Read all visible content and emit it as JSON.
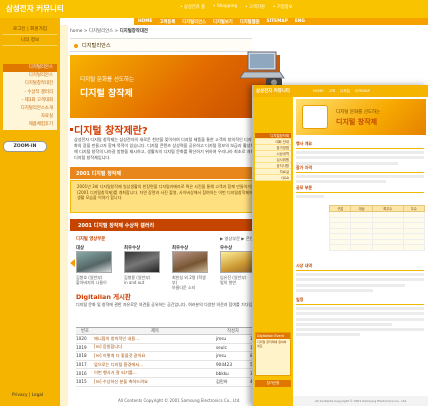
{
  "header": {
    "logo": "삼성전자 커뮤니티",
    "top_links": [
      "• 삼성전자 홈",
      "• Shopping",
      "• 고객지원",
      "• 기업정보"
    ],
    "nav": [
      "HOME",
      "고객등록",
      "디지털리안스",
      "디지털보기",
      "디지털웹원",
      "SITEMAP",
      "ENG"
    ]
  },
  "sidebar": {
    "top_items": [
      "로그인 | 회원가입",
      "나의 정보"
    ],
    "menu": [
      "디지털리안스",
      "디지털리안스",
      "디지털창작대전",
      "- 수상작 갤러리",
      "- 제3회 고객대회",
      "디지털리안스소개",
      "자료실",
      "제품체험후기"
    ],
    "zoom_button": "ZOOM-IN",
    "privacy": "Privacy   |   Legal"
  },
  "breadcrumb": {
    "prefix": "home > 디지털리안스 > ",
    "current": "디지털창작대전"
  },
  "page_title": "디지털리안스",
  "banner": {
    "sub": "디지털 문화를 선도하는",
    "main": "디지털 창작제"
  },
  "intro": {
    "title": "디지털 창작제란?",
    "text": "삼성전자 디지털 창작제는 삼성전자의 새로운 천년을 맞이하여 디지털 제품을 통한 고객의 창의적인 디지털 문화의 장을 만들고자 함에 목적이 있습니다. 디지털 콘텐츠 상상력을 공유하고 디지털 정보의 보급과 활성화를 위해 디지털 창작의 나아갈 방향을 제시하고, 생활속의 디지털 문화를 확산하기 위하여 우리나라 최초로 개최되는 디지털 창작제입니다."
  },
  "section1": {
    "title": "2001 디지털 창작제",
    "text": "2001년 3회 디지털창작제 일상생활의 한장면을 디지털카메라로 찍은 사진을 통해 고객과 함께 만들어가는 (2001 디지털창작제)를 개최합니다. 자연 장면과 사진 촬영, 사이버상에서 참여하는 이번 디지털창작제에서는 생활 모습을 이야기 합니다."
  },
  "section2": {
    "title": "2001 디지털 창작제 수상작 갤러리",
    "subcaption": "디지털 영상부문",
    "more": "▶ 영상부문 ▶ 콘텐츠부문",
    "thumbs": [
      {
        "cap": "대상",
        "name": "김봉호 (일반부)\n할아버지의 나들이"
      },
      {
        "cap": "최우수상",
        "name": "김병용 (일반부)\nin and out"
      },
      {
        "cap": "최우수상",
        "name": "최한성 외 2명 (학생부)\n아름다운 소리"
      },
      {
        "cap": "우수상",
        "name": "임유진 (일반부)\n빛의 향연"
      }
    ]
  },
  "board": {
    "title": "Digitalian 게시판",
    "desc": "디지털 문화 및 창작에 관한 자유로운 의견을 공유하는 공간입니다. 여러분의 다양한 의견과 참여를 기다립니다.",
    "columns": [
      "번호",
      "제목",
      "작성자",
      "조회"
    ],
    "rows": [
      [
        "1020",
        "애니팝의 창의적인 내용...",
        "jmsu",
        "11"
      ],
      [
        "1019",
        "[re] 응원합니다",
        "seulc",
        "19"
      ],
      [
        "1018",
        "[re] 이렇게 더 좋을것 같아요",
        "jmsu",
        "8"
      ],
      [
        "1017",
        "앞으로는 디지털 환경에서...",
        "904423",
        "53"
      ],
      [
        "1016",
        "이번 행사가 잘 되기를...",
        "bbkku",
        "35"
      ],
      [
        "1015",
        "[re] 수상하신 분들 축하드려요",
        "김민하",
        "46"
      ]
    ]
  },
  "copyright": "All Contents Copyright © 2001 Samsung Electronics Co., Ltd.",
  "front": {
    "logo": "삼성전자 커뮤니티",
    "nav": [
      "HOME",
      "고객",
      "디지털",
      "SITEMAP"
    ],
    "menu": [
      "디지털창작제",
      "대회 안내",
      "참가방법",
      "시상내역",
      "심사위원",
      "공지사항",
      "자료실",
      "Q&A"
    ],
    "banner_sub": "디지털 문화를 선도하는",
    "banner_main": "디지털 창작제",
    "sections": [
      "행사 개요",
      "참가 자격",
      "공모 부문",
      "시상 내역",
      "일정"
    ],
    "table_head": [
      "구분",
      "대상",
      "최우수",
      "우수"
    ],
    "promo_head": "Digitalian Event",
    "promo_text": "디지털 창작제에 참여하세요",
    "promo_button": "참가신청",
    "footer": "All Contents Copyright © 2001 Samsung Electronics Co., Ltd."
  },
  "colors": {
    "yellow": "#f9c300",
    "orange": "#e8861b",
    "dark_orange": "#c54400",
    "title_red": "#d03c00"
  }
}
